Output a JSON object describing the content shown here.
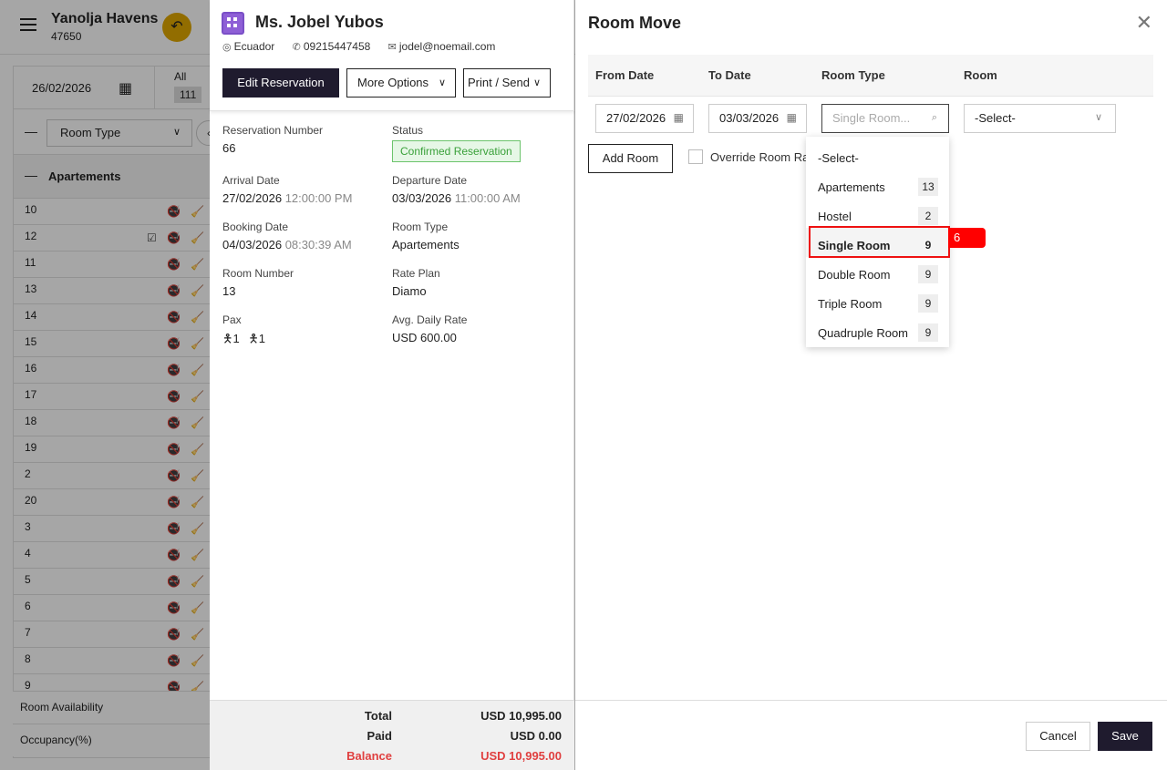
{
  "app": {
    "hotel_name": "Yanolja Havens",
    "hotel_id": "47650"
  },
  "background": {
    "date": "26/02/2026",
    "all_label": "All",
    "all_count": "111",
    "room_type_filter": "Room Type",
    "group_label": "Apartements",
    "rooms": [
      {
        "number": "10",
        "checked": false
      },
      {
        "number": "12",
        "checked": true
      },
      {
        "number": "11",
        "checked": false
      },
      {
        "number": "13",
        "checked": false
      },
      {
        "number": "14",
        "checked": false
      },
      {
        "number": "15",
        "checked": false
      },
      {
        "number": "16",
        "checked": false
      },
      {
        "number": "17",
        "checked": false
      },
      {
        "number": "18",
        "checked": false
      },
      {
        "number": "19",
        "checked": false
      },
      {
        "number": "2",
        "checked": false
      },
      {
        "number": "20",
        "checked": false
      },
      {
        "number": "3",
        "checked": false
      },
      {
        "number": "4",
        "checked": false
      },
      {
        "number": "5",
        "checked": false
      },
      {
        "number": "6",
        "checked": false
      },
      {
        "number": "7",
        "checked": false
      },
      {
        "number": "8",
        "checked": false
      },
      {
        "number": "9",
        "checked": false
      }
    ],
    "footer_availability": "Room Availability",
    "footer_occupancy": "Occupancy(%)"
  },
  "reservation": {
    "guest_name": "Ms. Jobel Yubos",
    "country": "Ecuador",
    "phone": "09215447458",
    "email": "jodel@noemail.com",
    "edit_label": "Edit Reservation",
    "more_label": "More Options",
    "print_label": "Print / Send",
    "reservation_number_label": "Reservation Number",
    "reservation_number": "66",
    "status_label": "Status",
    "status": "Confirmed Reservation",
    "arrival_label": "Arrival Date",
    "arrival_date": "27/02/2026",
    "arrival_time": "12:00:00 PM",
    "departure_label": "Departure Date",
    "departure_date": "03/03/2026",
    "departure_time": "11:00:00 AM",
    "booking_label": "Booking Date",
    "booking_date": "04/03/2026",
    "booking_time": "08:30:39 AM",
    "room_type_label": "Room Type",
    "room_type": "Apartements",
    "room_number_label": "Room Number",
    "room_number": "13",
    "rate_plan_label": "Rate Plan",
    "rate_plan": "Diamo",
    "pax_label": "Pax",
    "pax_adults": "1",
    "pax_children": "1",
    "adr_label": "Avg. Daily Rate",
    "adr": "USD 600.00",
    "total_label": "Total",
    "total": "USD 10,995.00",
    "paid_label": "Paid",
    "paid": "USD 0.00",
    "balance_label": "Balance",
    "balance": "USD 10,995.00"
  },
  "room_move": {
    "title": "Room Move",
    "col_from": "From Date",
    "col_to": "To Date",
    "col_type": "Room Type",
    "col_room": "Room",
    "from_date": "27/02/2026",
    "to_date": "03/03/2026",
    "room_type_placeholder": "Single Room...",
    "room_value": "-Select-",
    "add_room_label": "Add Room",
    "override_label": "Override Room Rate",
    "dropdown": [
      {
        "label": "-Select-",
        "count": ""
      },
      {
        "label": "Apartements",
        "count": "13"
      },
      {
        "label": "Hostel",
        "count": "2"
      },
      {
        "label": "Single Room",
        "count": "9"
      },
      {
        "label": "Double Room",
        "count": "9"
      },
      {
        "label": "Triple Room",
        "count": "9"
      },
      {
        "label": "Quadruple Room",
        "count": "9"
      }
    ],
    "highlight_tag": "6",
    "cancel_label": "Cancel",
    "save_label": "Save"
  }
}
